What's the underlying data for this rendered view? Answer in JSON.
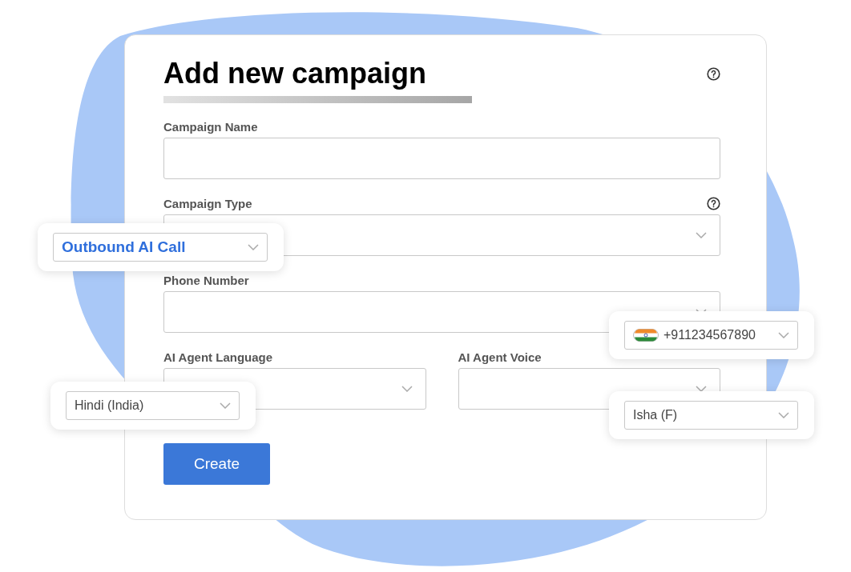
{
  "form": {
    "title": "Add new campaign",
    "fields": [
      {
        "label": "Campaign Name",
        "kind": "text",
        "help": false
      },
      {
        "label": "Campaign Type",
        "kind": "select",
        "help": true
      },
      {
        "label": "Phone Number",
        "kind": "select",
        "help": false
      },
      {
        "label": "AI Agent Language",
        "kind": "select",
        "help": false,
        "half": true
      },
      {
        "label": "AI Agent Voice",
        "kind": "select",
        "help": false,
        "half": true
      }
    ],
    "submit": "Create"
  },
  "callouts": [
    {
      "value": "Outbound AI Call",
      "kind": "select",
      "highlighted": true
    },
    {
      "value": "+911234567890",
      "kind": "phone",
      "highlighted": false
    },
    {
      "value": "Hindi (India)",
      "kind": "select",
      "highlighted": false
    },
    {
      "value": "Isha (F)",
      "kind": "select",
      "highlighted": false
    }
  ]
}
